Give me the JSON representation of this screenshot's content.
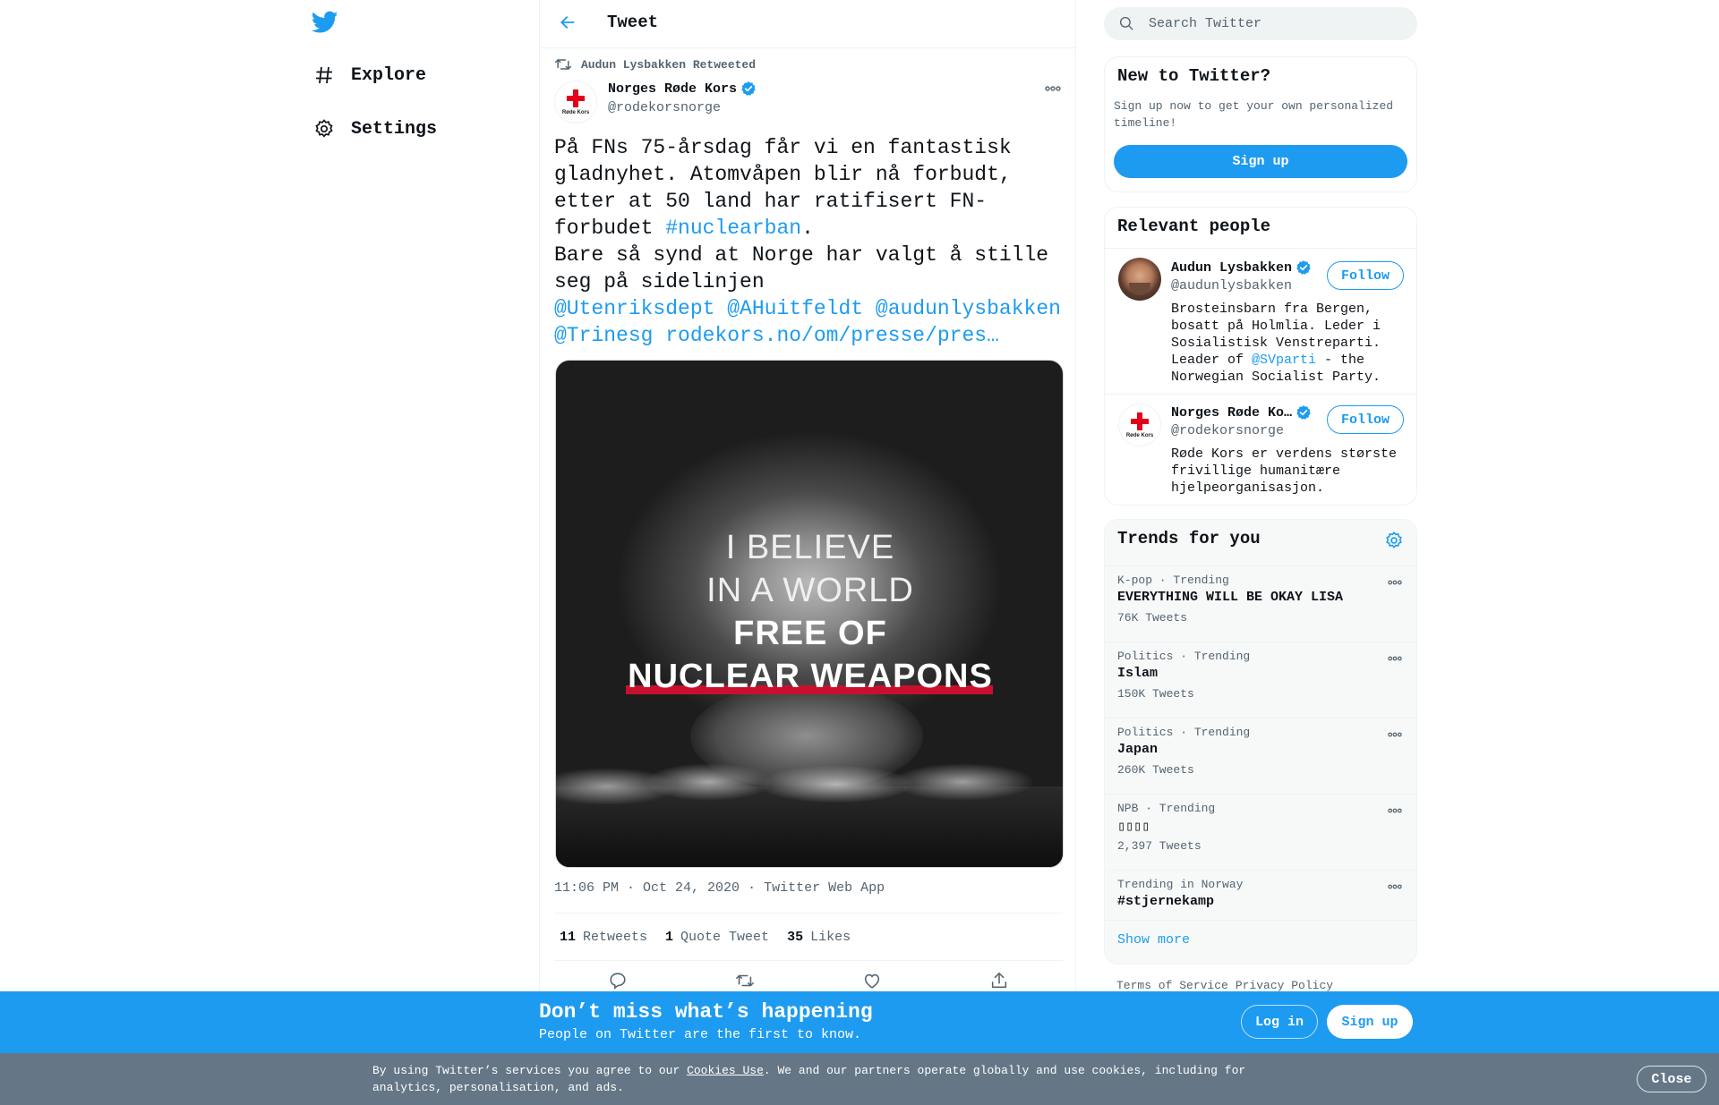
{
  "colors": {
    "accent": "#1d9bf0",
    "text": "#0f1419",
    "muted": "#536471",
    "cookie_bar": "#657786",
    "red_cross": "#e4001b"
  },
  "leftnav": {
    "logo_icon": "twitter-bird-icon",
    "items": [
      {
        "label": "Explore",
        "icon": "hashtag-icon"
      },
      {
        "label": "Settings",
        "icon": "gear-icon"
      }
    ]
  },
  "header": {
    "title": "Tweet",
    "back_icon": "arrow-left-icon"
  },
  "tweet": {
    "retweeted_by": "Audun Lysbakken Retweeted",
    "author": {
      "name": "Norges Røde Kors",
      "handle": "@rodekorsnorge",
      "avatar_text": "Røde Kors",
      "verified": true
    },
    "text": {
      "part1": "På FNs 75-årsdag får vi en fantastisk\ngladnyhet. Atomvåpen blir nå forbudt,\netter at 50 land har ratifisert FN-\nforbudet ",
      "hashtag": "#nuclearban",
      "part2": ".\nBare så synd at Norge har valgt å stille\nseg på sidelinjen\n",
      "mention1": "@Utenriksdept",
      "mention2": "@AHuitfeldt",
      "mention3": "@audunlysbakken",
      "mention4": "@Trinesg",
      "link": "rodekors.no/om/presse/pres…"
    },
    "media": {
      "line1": "I BELIEVE",
      "line2": "IN A WORLD",
      "line3": "FREE OF",
      "line4": "NUCLEAR WEAPONS"
    },
    "time": "11:06 PM · Oct 24, 2020",
    "separator": "·",
    "source": "Twitter Web App",
    "counts": [
      {
        "value": "11",
        "label": "Retweets"
      },
      {
        "value": "1",
        "label": "Quote Tweet"
      },
      {
        "value": "35",
        "label": "Likes"
      }
    ],
    "actions": [
      "reply-icon",
      "retweet-icon",
      "like-icon",
      "share-icon"
    ]
  },
  "search": {
    "placeholder": "Search Twitter"
  },
  "new_to_twitter": {
    "title": "New to Twitter?",
    "desc": "Sign up now to get your own personalized timeline!",
    "button": "Sign up"
  },
  "relevant_people": {
    "title": "Relevant people",
    "people": [
      {
        "name": "Audun Lysbakken",
        "handle": "@audunlysbakken",
        "bio_part1": "Brosteinsbarn fra Bergen, bosatt på Holmlia. Leder i Sosialistisk Venstreparti. Leader of ",
        "bio_mention": "@SVparti",
        "bio_part2": " - the Norwegian Socialist Party.",
        "follow": "Follow"
      },
      {
        "name": "Norges Røde Ko…",
        "handle": "@rodekorsnorge",
        "bio": "Røde Kors er verdens største frivillige humanitære hjelpeorganisasjon.",
        "follow": "Follow"
      }
    ]
  },
  "trends": {
    "title": "Trends for you",
    "items": [
      {
        "context": "K-pop · Trending",
        "name": "EVERYTHING WILL BE OKAY LISA",
        "count": "76K Tweets"
      },
      {
        "context": "Politics · Trending",
        "name": "Islam",
        "count": "150K Tweets"
      },
      {
        "context": "Politics · Trending",
        "name": "Japan",
        "count": "260K Tweets"
      },
      {
        "context": "NPB · Trending",
        "name": "▯▯▯▯",
        "count": "2,397 Tweets"
      },
      {
        "context": "Trending in Norway",
        "name": "#stjernekamp",
        "count": ""
      }
    ],
    "show_more": "Show more"
  },
  "footer": {
    "terms": "Terms of Service",
    "privacy": "Privacy Policy"
  },
  "banner": {
    "title": "Don’t miss what’s happening",
    "subtitle": "People on Twitter are the first to know.",
    "login": "Log in",
    "signup": "Sign up"
  },
  "cookie": {
    "text_before": "By using Twitter’s services you agree to our ",
    "link": "Cookies Use",
    "text_after": ". We and our partners operate globally and use cookies, including for analytics, personalisation, and ads.",
    "close": "Close"
  }
}
